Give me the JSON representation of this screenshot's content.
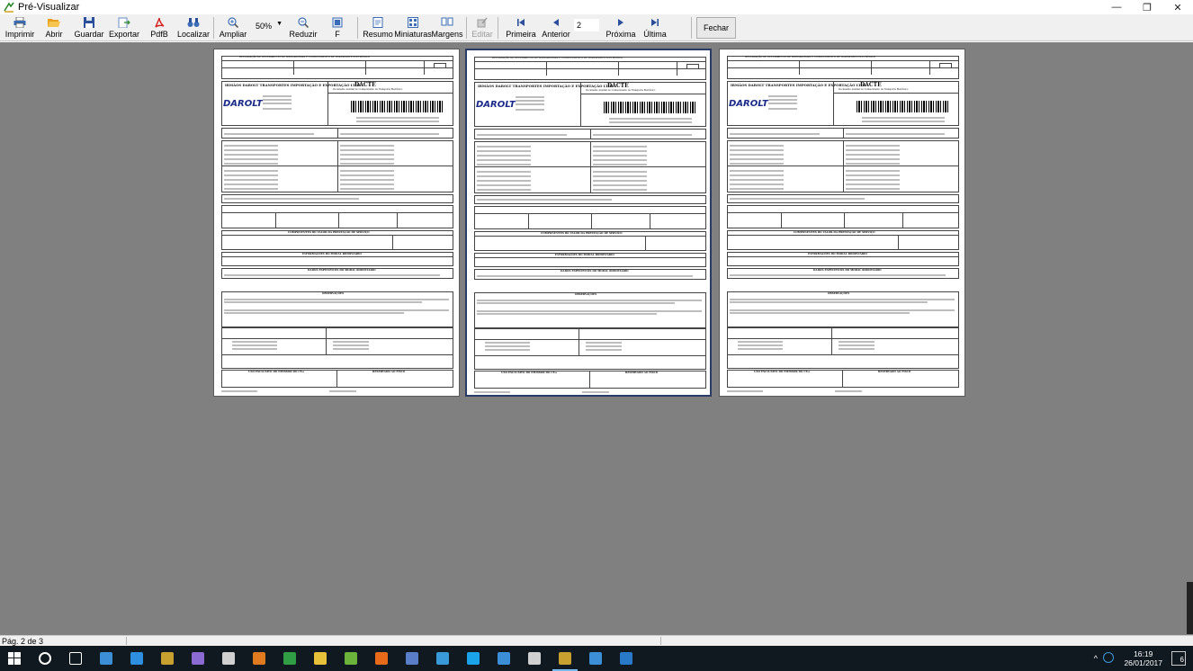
{
  "window": {
    "title": "Pré-Visualizar",
    "controls": {
      "minimize": "—",
      "maximize": "❐",
      "close": "✕"
    }
  },
  "toolbar": {
    "buttons": [
      {
        "label": "Imprimir",
        "icon": "printer-icon",
        "color": "#3a6db5"
      },
      {
        "label": "Abrir",
        "icon": "folder-open-icon",
        "color": "#e8a020"
      },
      {
        "label": "Guardar",
        "icon": "floppy-disk-icon",
        "color": "#2c4f9c"
      },
      {
        "label": "Exportar",
        "icon": "export-icon",
        "color": "#6a8bc4"
      },
      {
        "label": "PdfB",
        "icon": "pdf-icon",
        "color": "#d42020"
      },
      {
        "label": "Localizar",
        "icon": "binoculars-icon",
        "color": "#3a6db5"
      },
      {
        "label": "Ampliar",
        "icon": "zoom-in-icon",
        "color": "#3a6db5"
      },
      {
        "label": "Reduzir",
        "icon": "zoom-out-icon",
        "color": "#3a6db5"
      },
      {
        "label": "F",
        "icon": "full-page-icon",
        "color": "#3a6db5"
      },
      {
        "label": "Resumo",
        "icon": "outline-icon",
        "color": "#3a6db5"
      },
      {
        "label": "Miniaturas",
        "icon": "thumbnails-icon",
        "color": "#3a6db5"
      },
      {
        "label": "Margens",
        "icon": "margins-icon",
        "color": "#3a6db5"
      },
      {
        "label": "Editar",
        "icon": "edit-icon",
        "color": "#9a9a9a",
        "disabled": true
      },
      {
        "label": "Primeira",
        "icon": "first-page-icon",
        "color": "#2c4f9c"
      },
      {
        "label": "Anterior",
        "icon": "previous-page-icon",
        "color": "#2c4f9c"
      },
      {
        "label": "Próxima",
        "icon": "next-page-icon",
        "color": "#2c4f9c"
      },
      {
        "label": "Última",
        "icon": "last-page-icon",
        "color": "#2c4f9c"
      }
    ],
    "zoom_value": "50%",
    "page_number": "2",
    "close_label": "Fechar"
  },
  "pages": [
    {
      "sheet": "1",
      "header_line": "DECLARAÇÃO DE RECEBIMENTO DE MERCADORIAS E CONHECIMENTO DE TRANSPORTE ELETRÔNICO",
      "company": "IRMÃOS DAROLT TRANSPORTES IMPORTAÇÃO E EXPORTAÇÃO LTDA",
      "doc_title": "DACTE",
      "doc_subtitle": "Documento Auxiliar do Conhecimento de Transporte Eletrônico",
      "logo": "DAROLT",
      "section_service": "COMPONENTES DO VALOR DA PRESTAÇÃO DE SERVIÇO",
      "section_info": "INFORMAÇÕES DO MODAL RODOVIÁRIO",
      "section_obs": "OBSERVAÇÕES",
      "section_recv": "DADOS ESPECÍFICOS DO MODAL RODOVIÁRIO",
      "section_sign": "USO EXCLUSIVO DO EMISSOR DO CT-e",
      "section_fisco": "RESERVADO AO FISCO"
    },
    {
      "sheet": "2",
      "header_line": "DECLARAÇÃO DE RECEBIMENTO DE MERCADORIAS E CONHECIMENTO DE TRANSPORTE ELETRÔNICO",
      "company": "IRMÃOS DAROLT TRANSPORTES IMPORTAÇÃO E EXPORTAÇÃO LTDA",
      "doc_title": "DACTE",
      "doc_subtitle": "Documento Auxiliar do Conhecimento de Transporte Eletrônico",
      "logo": "DAROLT",
      "section_service": "COMPONENTES DO VALOR DA PRESTAÇÃO DE SERVIÇO",
      "section_info": "INFORMAÇÕES DO MODAL RODOVIÁRIO",
      "section_obs": "OBSERVAÇÕES",
      "section_recv": "DADOS ESPECÍFICOS DO MODAL RODOVIÁRIO",
      "section_sign": "USO EXCLUSIVO DO EMISSOR DO CT-e",
      "section_fisco": "RESERVADO AO FISCO"
    },
    {
      "sheet": "3",
      "header_line": "DECLARAÇÃO DE RECEBIMENTO DE MERCADORIAS E CONHECIMENTO DE TRANSPORTE ELETRÔNICO",
      "company": "IRMÃOS DAROLT TRANSPORTES IMPORTAÇÃO E EXPORTAÇÃO LTDA",
      "doc_title": "DACTE",
      "doc_subtitle": "Documento Auxiliar do Conhecimento de Transporte Eletrônico",
      "logo": "DAROLT",
      "section_service": "COMPONENTES DO VALOR DA PRESTAÇÃO DE SERVIÇO",
      "section_info": "INFORMAÇÕES DO MODAL RODOVIÁRIO",
      "section_obs": "OBSERVAÇÕES",
      "section_recv": "DADOS ESPECÍFICOS DO MODAL RODOVIÁRIO",
      "section_sign": "USO EXCLUSIVO DO EMISSOR DO CT-e",
      "section_fisco": "RESERVADO AO FISCO"
    }
  ],
  "active_page": "2",
  "statusbar": {
    "page_info": "Pág. 2 de 3"
  },
  "taskbar": {
    "apps": [
      {
        "name": "start",
        "icon": "windows-start-icon",
        "color": "#ffffff"
      },
      {
        "name": "search",
        "icon": "search-circle-icon",
        "color": "#ffffff"
      },
      {
        "name": "task-view",
        "icon": "task-view-icon",
        "color": "#ffffff"
      },
      {
        "name": "app1",
        "icon": "app-window-icon",
        "color": "#3c8ed6"
      },
      {
        "name": "edge",
        "icon": "edge-icon",
        "color": "#2e8fe0"
      },
      {
        "name": "app2",
        "icon": "preview-app-icon",
        "color": "#c8a030"
      },
      {
        "name": "app3",
        "icon": "visual-studio-icon",
        "color": "#8a6bd1"
      },
      {
        "name": "app4",
        "icon": "photo-app-icon",
        "color": "#d0d0d0"
      },
      {
        "name": "app5",
        "icon": "orange-app-icon",
        "color": "#e07b20"
      },
      {
        "name": "chrome",
        "icon": "chrome-icon",
        "color": "#2f9e44"
      },
      {
        "name": "explorer",
        "icon": "file-explorer-icon",
        "color": "#e8c13a"
      },
      {
        "name": "app6",
        "icon": "green-app-icon",
        "color": "#6bb33a"
      },
      {
        "name": "firefox",
        "icon": "firefox-icon",
        "color": "#e86a1a"
      },
      {
        "name": "app7",
        "icon": "tool-app-icon",
        "color": "#5a7ec8"
      },
      {
        "name": "app8",
        "icon": "circle-app-icon",
        "color": "#3a9ad9"
      },
      {
        "name": "skype",
        "icon": "skype-icon",
        "color": "#1aa3e8"
      },
      {
        "name": "app9",
        "icon": "remote-desktop-icon",
        "color": "#3c8ed6"
      },
      {
        "name": "app10",
        "icon": "paint-app-icon",
        "color": "#d0d0d0"
      },
      {
        "name": "app11",
        "icon": "preview-app-icon-2",
        "color": "#c8a030"
      },
      {
        "name": "app12",
        "icon": "network-app-icon",
        "color": "#3c8ed6"
      },
      {
        "name": "outlook",
        "icon": "outlook-icon",
        "color": "#2a78c8"
      }
    ],
    "tray": {
      "chevron": "^",
      "time": "16:19",
      "date": "26/01/2017",
      "notifications": "6"
    }
  }
}
